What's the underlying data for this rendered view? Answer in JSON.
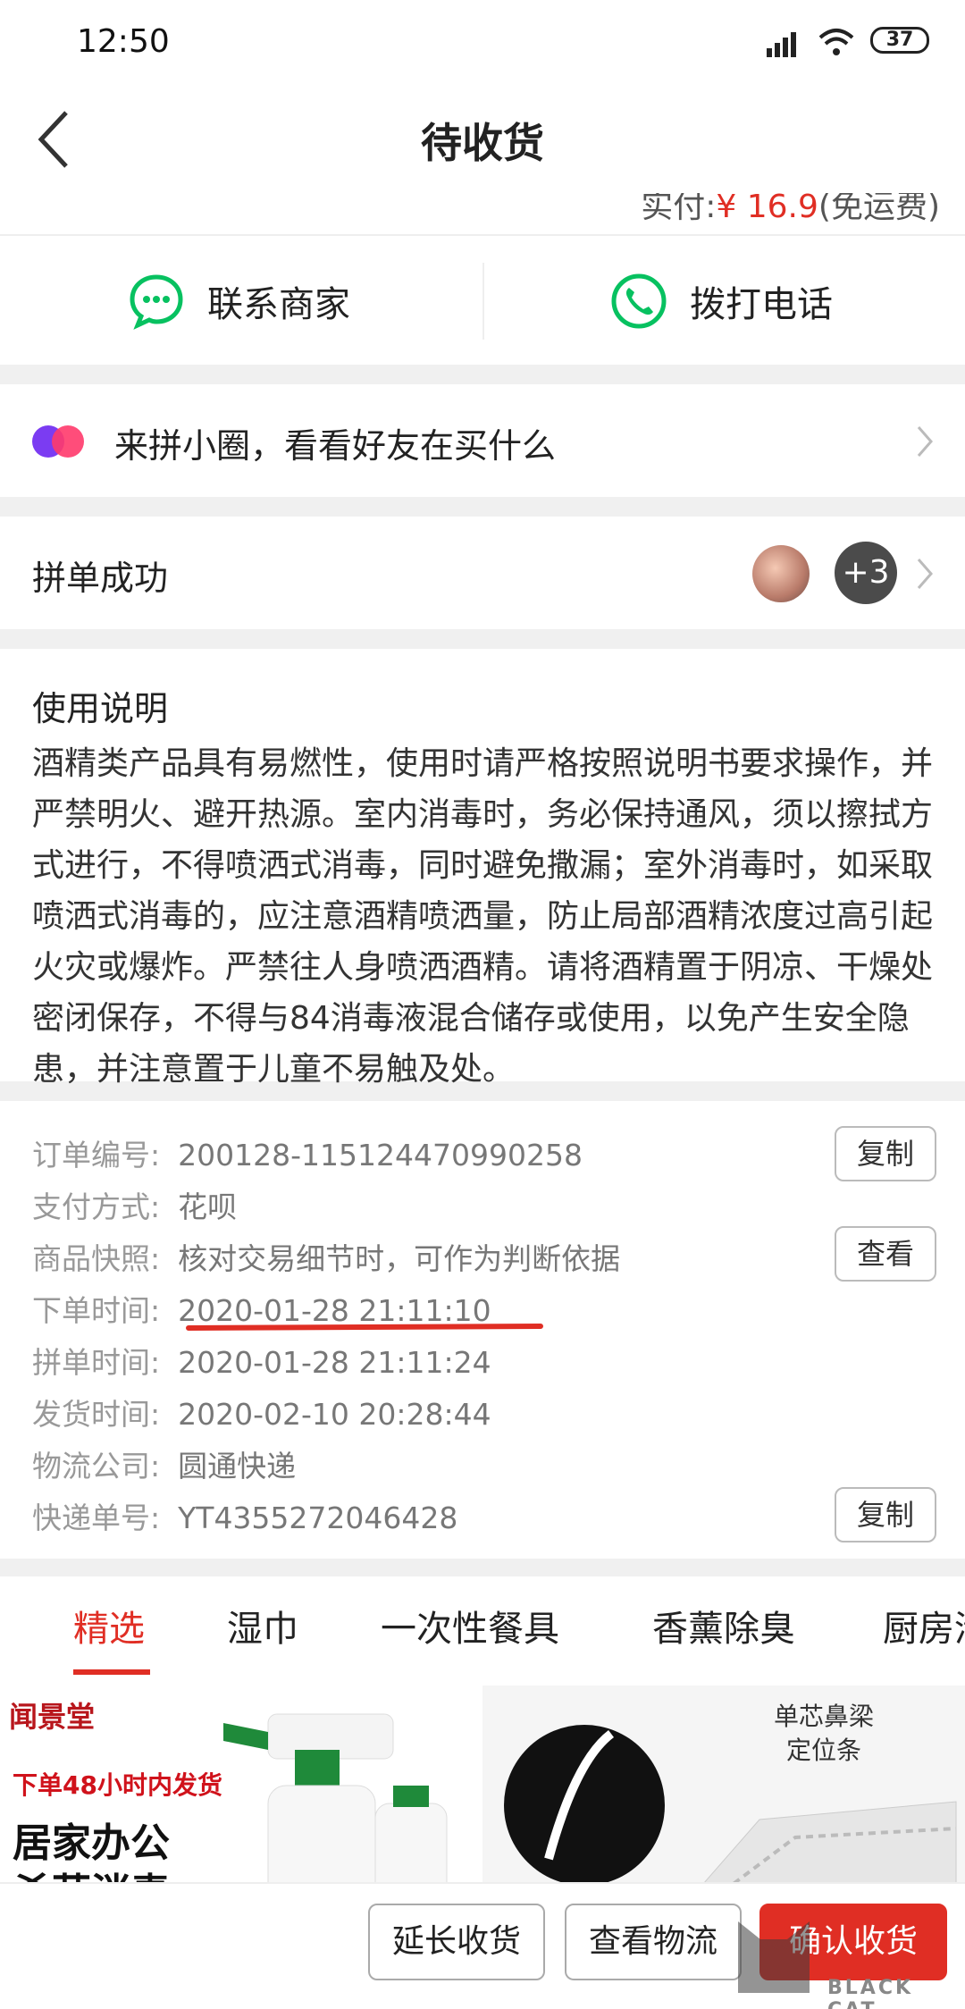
{
  "status_bar": {
    "time": "12:50",
    "battery": "37"
  },
  "header": {
    "title": "待收货"
  },
  "cutoff": {
    "prefix": "实付:",
    "amount": "¥ 16.9",
    "suffix": "(免运费)"
  },
  "contact": {
    "merchant_label": "联系商家",
    "phone_label": "拨打电话"
  },
  "circle": {
    "label": "来拼小圈，看看好友在买什么"
  },
  "group": {
    "label": "拼单成功",
    "more_count": "+3"
  },
  "usage": {
    "title": "使用说明",
    "body": "酒精类产品具有易燃性，使用时请严格按照说明书要求操作，并严禁明火、避开热源。室内消毒时，务必保持通风，须以擦拭方式进行，不得喷洒式消毒，同时避免撒漏；室外消毒时，如采取喷洒式消毒的，应注意酒精喷洒量，防止局部酒精浓度过高引起火灾或爆炸。严禁往人身喷洒酒精。请将酒精置于阴凉、干燥处密闭保存，不得与84消毒液混合储存或使用，以免产生安全隐患，并注意置于儿童不易触及处。"
  },
  "order": {
    "rows": [
      {
        "label": "订单编号:",
        "value": "200128-115124470990258"
      },
      {
        "label": "支付方式:",
        "value": "花呗"
      },
      {
        "label": "商品快照:",
        "value": "核对交易细节时，可作为判断依据"
      },
      {
        "label": "下单时间:",
        "value": "2020-01-28 21:11:10"
      },
      {
        "label": "拼单时间:",
        "value": "2020-01-28 21:11:24"
      },
      {
        "label": "发货时间:",
        "value": "2020-02-10 20:28:44"
      },
      {
        "label": "物流公司:",
        "value": "圆通快递"
      },
      {
        "label": "快递单号:",
        "value": "YT4355272046428"
      }
    ],
    "copy_label": "复制",
    "view_label": "查看",
    "copy2_label": "复制"
  },
  "tabs": [
    "精选",
    "湿巾",
    "一次性餐具",
    "香薰除臭",
    "厨房清"
  ],
  "products": {
    "left": {
      "brand": "闻景堂",
      "promo": "下单48小时内发货",
      "headline": "居家办公",
      "headline2": "杀菌消毒"
    },
    "right": {
      "label": "单芯鼻梁\n定位条"
    }
  },
  "bottom": {
    "extend_label": "延长收货",
    "logistics_label": "查看物流",
    "confirm_label": "确认收货"
  },
  "watermark": {
    "text": "BLACK CAT"
  },
  "colors": {
    "accent": "#e02e24",
    "wechat_green": "#07c160"
  }
}
